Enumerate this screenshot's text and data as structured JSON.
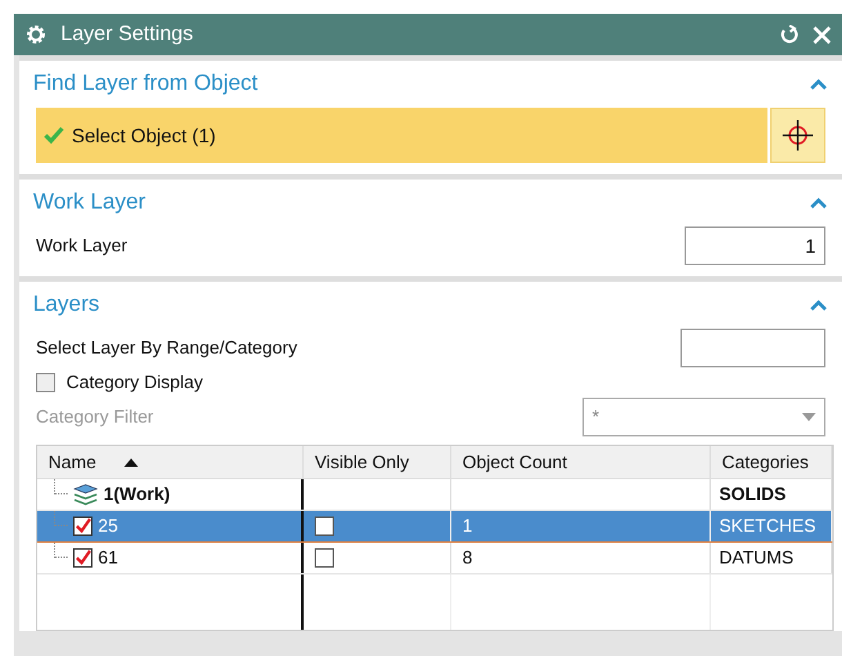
{
  "window": {
    "title": "Layer Settings"
  },
  "find_layer": {
    "title": "Find Layer from Object",
    "expanded": true,
    "select_label": "Select Object (1)",
    "complete": true
  },
  "work_layer": {
    "title": "Work Layer",
    "expanded": true,
    "label": "Work Layer",
    "value": "1"
  },
  "layers": {
    "title": "Layers",
    "expanded": true,
    "range_label": "Select Layer By Range/Category",
    "category_display": {
      "label": "Category Display",
      "checked": false
    },
    "category_filter": {
      "label": "Category Filter",
      "value": "*",
      "disabled": true
    },
    "table": {
      "columns": [
        {
          "label": "Name",
          "sorted": true
        },
        {
          "label": "Visible Only",
          "sorted": false
        },
        {
          "label": "Object Count",
          "sorted": false
        },
        {
          "label": "Categories",
          "sorted": false
        }
      ],
      "rows": [
        {
          "kind": "work",
          "name": "1(Work)",
          "category": "SOLIDS",
          "selected": false
        },
        {
          "kind": "layer",
          "name": "25",
          "checked": true,
          "visible_only": false,
          "object_count": "1",
          "category": "SKETCHES",
          "selected": true
        },
        {
          "kind": "layer",
          "name": "61",
          "checked": true,
          "visible_only": false,
          "object_count": "8",
          "category": "DATUMS",
          "selected": false
        }
      ]
    }
  }
}
